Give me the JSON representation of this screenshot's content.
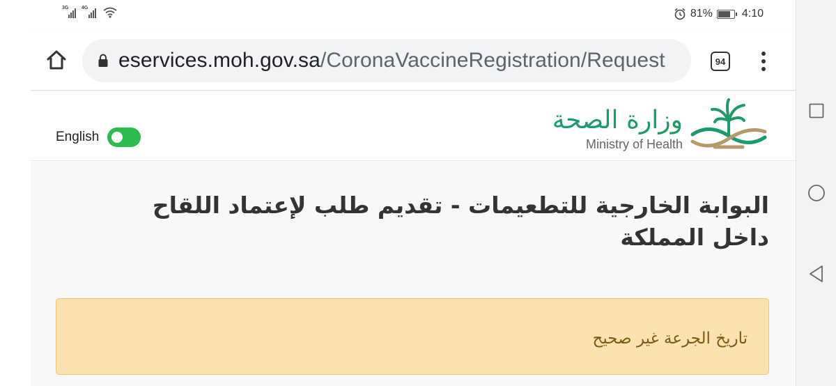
{
  "status_bar": {
    "signal_1_label": "3G",
    "signal_2_label": "4G",
    "battery_percent": "81%",
    "battery_level": 0.81,
    "time": "4:10",
    "icons": [
      "signal-icon",
      "signal-icon",
      "wifi-icon",
      "alarm-icon",
      "battery-icon"
    ]
  },
  "browser": {
    "url_domain": "eservices.moh.gov.sa",
    "url_path": "/CoronaVaccineRegistration/Request",
    "tab_count": "94",
    "icons": [
      "home-icon",
      "lock-icon",
      "tabs-icon",
      "menu-icon"
    ]
  },
  "site_header": {
    "language_label": "English",
    "language_toggle_on": true,
    "logo_arabic": "وزارة الصحة",
    "logo_english": "Ministry of Health"
  },
  "page": {
    "title": "البوابة الخارجية للتطعيمات - تقديم طلب لإعتماد اللقاح داخل المملكة",
    "alert_message": "تاريخ الجرعة غير صحيح"
  },
  "colors": {
    "toggle_green": "#2dbb4f",
    "logo_green": "#1c9a6a",
    "alert_background": "#fbe2b0",
    "alert_border": "#f0c577",
    "alert_text": "#7a5a12"
  },
  "system_nav": {
    "icons": [
      "recent-apps-icon",
      "home-circle-icon",
      "back-icon"
    ]
  }
}
